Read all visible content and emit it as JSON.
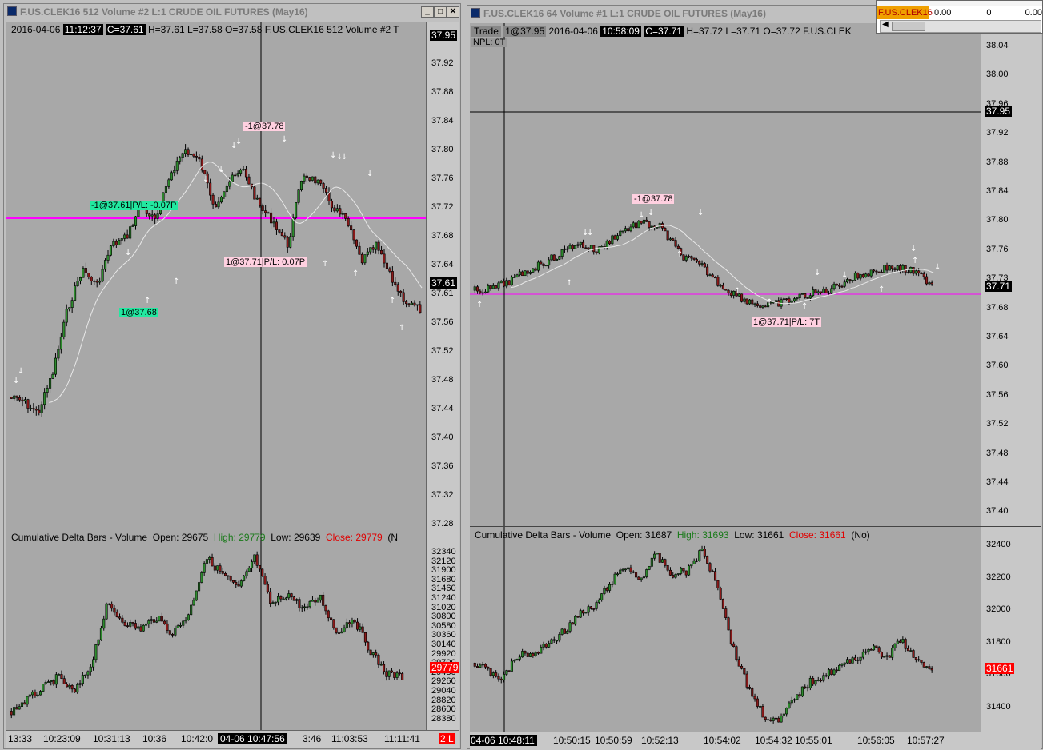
{
  "left": {
    "title": "F.US.CLEK16  512 Volume  #2  L:1  CRUDE OIL FUTURES (May16)",
    "header": {
      "date": "2016-04-06",
      "time": "11:12:37",
      "close": "C=37.61",
      "rest": "H=37.61 L=37.58 O=37.58 F.US.CLEK16  512 Volume  #2 T"
    },
    "price_ticks": [
      "37.95",
      "37.92",
      "37.88",
      "37.84",
      "37.80",
      "37.76",
      "37.72",
      "37.68",
      "37.64",
      "37.61",
      "37.56",
      "37.52",
      "37.48",
      "37.44",
      "37.40",
      "37.36",
      "37.32",
      "37.28"
    ],
    "current_price": "37.61",
    "top_price": "37.95",
    "labels": {
      "sell1": "-1@37.78",
      "sell2": "-1@37.61|P/L: -0.07P",
      "buy1": "1@37.68",
      "buy2": "1@37.71|P/L: 0.07P"
    },
    "delta": {
      "name": "Cumulative Delta Bars - Volume",
      "open_label": "Open:",
      "open": "29675",
      "high_label": "High:",
      "high": "29779",
      "low_label": "Low:",
      "low": "29639",
      "close_label": "Close:",
      "close": "29779",
      "tail": "(N",
      "ticks": [
        "32340",
        "32120",
        "31900",
        "31680",
        "31460",
        "31240",
        "31020",
        "30800",
        "30580",
        "30360",
        "30140",
        "29920",
        "29700",
        "29480",
        "29260",
        "29040",
        "28820",
        "28600",
        "28380"
      ],
      "current": "29779"
    },
    "time_ticks": [
      "13:33",
      "10:23:09",
      "10:31:13",
      "10:36",
      "10:42:0",
      "04-06  10:47:56",
      "3:46",
      "11:03:53",
      "11:11:41"
    ],
    "corner_badge": "2 L"
  },
  "right": {
    "title": "F.US.CLEK16  64 Volume  #1  L:1  CRUDE OIL FUTURES (May16)",
    "header": {
      "trade": "Trade",
      "trade_val": "1@37.95",
      "date": "2016-04-06",
      "time": "10:58:09",
      "close": "C=37.71",
      "rest": "H=37.72 L=37.71 O=37.72 F.US.CLEK",
      "npl": "NPL: 0T"
    },
    "price_ticks": [
      "38.04",
      "38.00",
      "37.96",
      "37.92",
      "37.88",
      "37.84",
      "37.80",
      "37.76",
      "37.73",
      "37.68",
      "37.64",
      "37.60",
      "37.56",
      "37.52",
      "37.48",
      "37.44",
      "37.40"
    ],
    "current_price": "37.71",
    "top_price": "37.95",
    "labels": {
      "sell1": "-1@37.78",
      "buy1": "1@37.71|P/L: 7T"
    },
    "delta": {
      "name": "Cumulative Delta Bars - Volume",
      "open_label": "Open:",
      "open": "31687",
      "high_label": "High:",
      "high": "31693",
      "low_label": "Low:",
      "low": "31661",
      "close_label": "Close:",
      "close": "31661",
      "tail": "(No)",
      "ticks": [
        "32400",
        "32200",
        "32000",
        "31800",
        "31600",
        "31400"
      ],
      "current": "31661"
    },
    "time_ticks": [
      "04-06  10:48:11",
      "10:50:15",
      "10:50:59",
      "10:52:13",
      "10:54:02",
      "10:54:32",
      "10:55:01",
      "10:56:05",
      "10:57:27"
    ]
  },
  "dom": {
    "symbol": "F.US.CLEK16",
    "v1": "0.00",
    "v2": "0",
    "v3": "0.00"
  },
  "colors": {
    "chart_bg": "#a8a8a8",
    "magenta_line": "#ff00ff",
    "up_bar": "#2e8b2e",
    "down_bar": "#8b1a1a"
  }
}
